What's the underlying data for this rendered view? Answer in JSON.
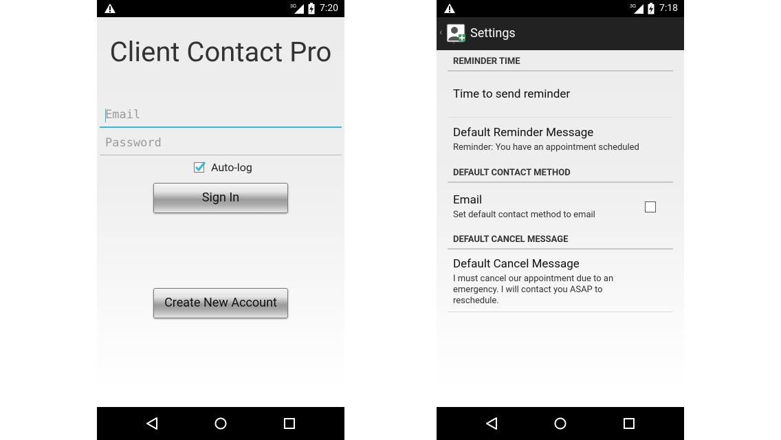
{
  "login": {
    "status": {
      "time": "7:20"
    },
    "app_title": "Client Contact Pro",
    "email_placeholder": "Email",
    "password_placeholder": "Password",
    "autolog_label": "Auto-log",
    "autolog_checked": true,
    "sign_in_label": "Sign In",
    "create_account_label": "Create New Account"
  },
  "settings": {
    "status": {
      "time": "7:18"
    },
    "title": "Settings",
    "sections": [
      {
        "header": "REMINDER TIME",
        "items": [
          {
            "title": "Time to send reminder"
          },
          {
            "title": "Default Reminder Message",
            "summary": "Reminder: You have an appointment scheduled"
          }
        ]
      },
      {
        "header": "DEFAULT CONTACT METHOD",
        "items": [
          {
            "title": "Email",
            "summary": "Set default contact method to email",
            "checked": false
          }
        ]
      },
      {
        "header": "DEFAULT CANCEL MESSAGE",
        "items": [
          {
            "title": "Default Cancel Message",
            "summary": "I must cancel our appointment due to an emergency. I will contact you ASAP to reschedule."
          }
        ]
      }
    ]
  },
  "status_icons": [
    "warning-icon",
    "signal-3g-icon",
    "battery-charging-icon"
  ],
  "nav_icons": [
    "back-icon",
    "home-icon",
    "recent-apps-icon"
  ],
  "colors": {
    "accent": "#33b5e5",
    "checkbox": "#33b5e5",
    "actionbar": "#222222"
  }
}
